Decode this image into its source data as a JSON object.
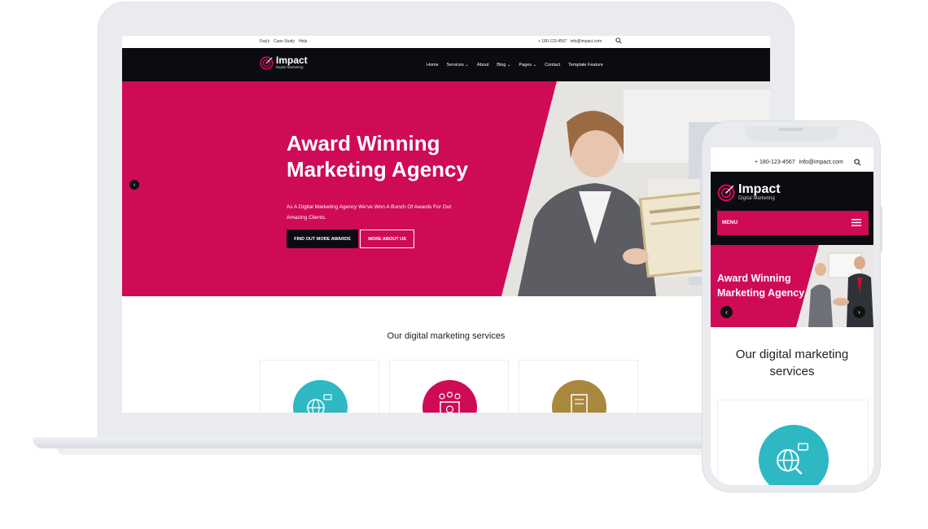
{
  "colors": {
    "brand": "#cf0a57",
    "dark": "#0a0c12",
    "teal": "#2eb8c4",
    "gold": "#a9873d"
  },
  "desktop": {
    "topbar": {
      "links": [
        "Faq's",
        "Case Study",
        "Help"
      ],
      "phone": "+ 180-123-4567",
      "email": "info@impact.com",
      "search_icon": "search-icon"
    },
    "logo": {
      "name": "Impact",
      "tagline": "Digital Marketing"
    },
    "nav": [
      "Home",
      "Services",
      "About",
      "Blog",
      "Pages",
      "Contact",
      "Template Feature"
    ],
    "hero": {
      "title_line1": "Award Winning",
      "title_line2": "Marketing Agency",
      "subtitle_line1": "As A Digital Marketing Agency We've Won A Bunch Of Awards For Out",
      "subtitle_line2": "Amazing Clients.",
      "primary_button": "FIND OUT MORE AWARDS",
      "secondary_button": "MORE ABOUT US"
    },
    "services_title": "Our digital marketing services"
  },
  "mobile": {
    "topbar": {
      "phone": "+ 180-123-4567",
      "email": "info@impact.com"
    },
    "logo": {
      "name": "Impact",
      "tagline": "Digital Marketing"
    },
    "menu_label": "MENU",
    "hero": {
      "title_line1": "Award Winning",
      "title_line2": "Marketing Agency"
    },
    "services_title": "Our digital marketing services"
  }
}
